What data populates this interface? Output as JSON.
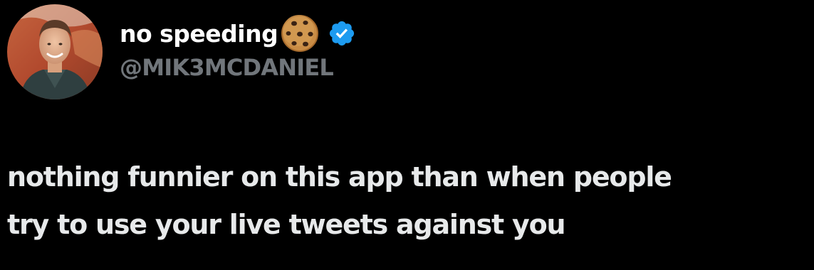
{
  "author": {
    "display_name": "no speeding",
    "handle": "@MIK3MCDANIEL",
    "name_emoji_icon": "cookie-icon",
    "badge_icon": "verified-badge-icon",
    "badge_color": "#1d9bf0"
  },
  "tweet": {
    "lines": [
      "nothing funnier on this app than when people",
      "try to use your live tweets against you"
    ]
  },
  "colors": {
    "background": "#000000",
    "name_text": "#ffffff",
    "handle_text": "#71767b",
    "body_text": "#e7e9ea"
  }
}
